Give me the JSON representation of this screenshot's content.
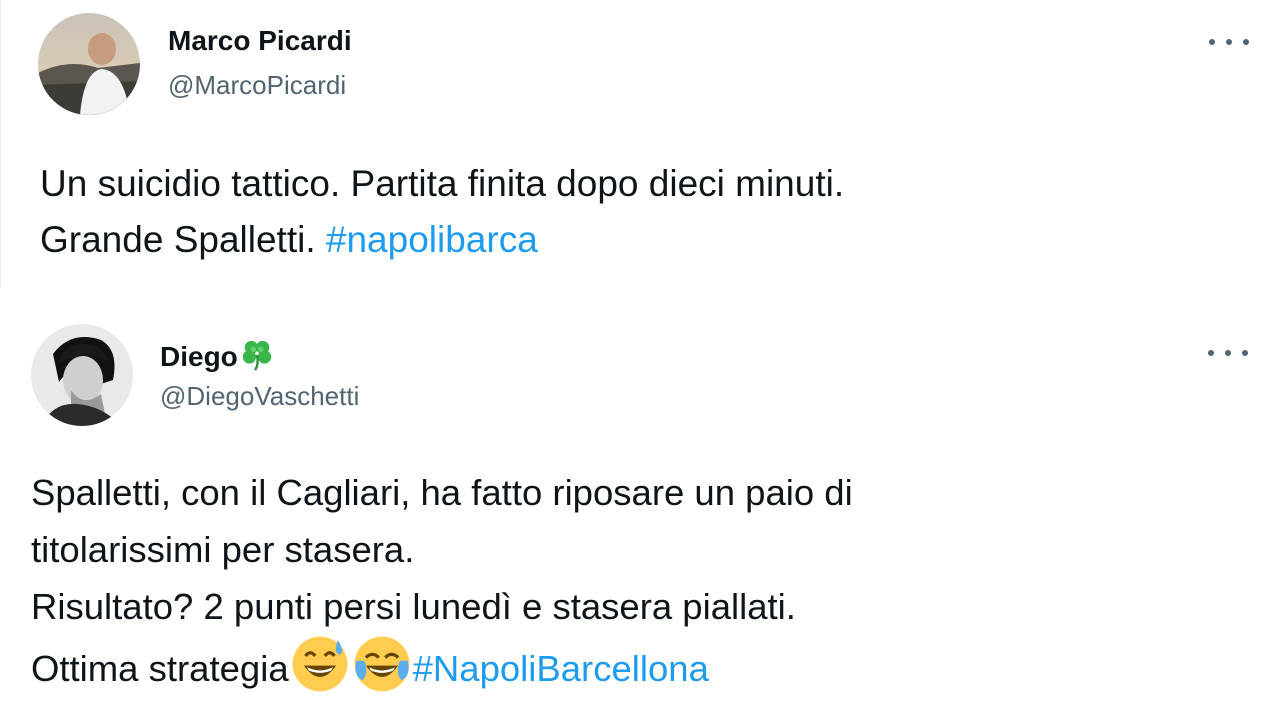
{
  "tweets": [
    {
      "author_name": "Marco Picardi",
      "author_handle": "@MarcoPicardi",
      "line1": "Un suicidio tattico. Partita finita dopo dieci minuti.",
      "line2_text": "Grande Spalletti. ",
      "hashtag": "#napolibarca"
    },
    {
      "author_name": "Diego",
      "author_handle": "@DiegoVaschetti",
      "name_emoji_icon": "four-leaf-clover-icon",
      "line1": "Spalletti, con il Cagliari, ha fatto riposare un paio di",
      "line2": "titolarissimi per stasera.",
      "line3": "Risultato? 2 punti persi lunedì e stasera piallati.",
      "line4_text": "Ottima strategia",
      "emojis": [
        "grinning-face-with-sweat-icon",
        "face-with-tears-of-joy-icon"
      ],
      "hashtag": "#NapoliBarcellona"
    }
  ],
  "colors": {
    "text": "#0f1419",
    "secondary": "#536471",
    "link": "#1d9bf0"
  }
}
